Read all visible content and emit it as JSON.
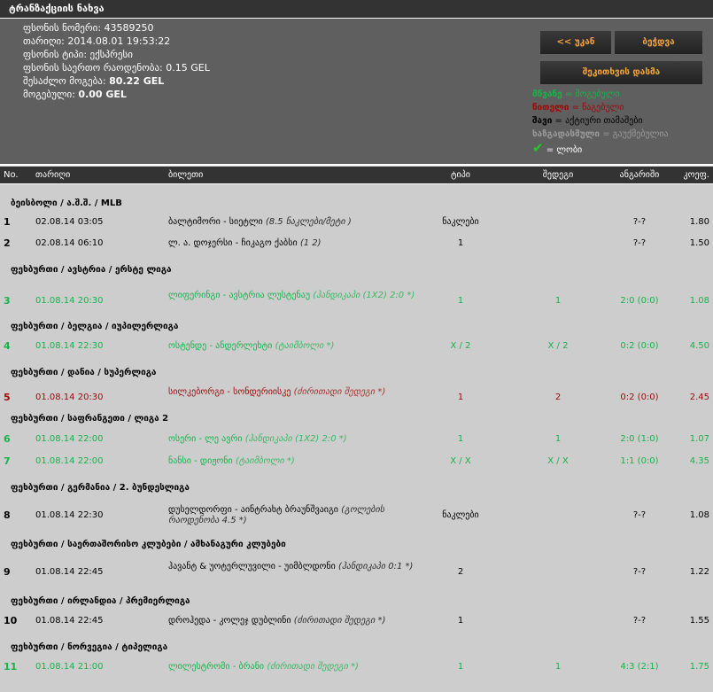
{
  "title": "ტრანზაქციის ნახვა",
  "info": {
    "bet_number_label": "ფსონის ნომერი:",
    "bet_number": "43589250",
    "date_label": "თარიღი:",
    "date": "2014.08.01 19:53:22",
    "bet_type_label": "ფსონის ტიპი:",
    "bet_type": "ექსპრესი",
    "stake_label": "ფსონის საერთო რაოდენობა:",
    "stake": "0.15 GEL",
    "possible_win_label": "შესაძლო მოგება:",
    "possible_win": "80.22 GEL",
    "won_label": "მოგებული:",
    "won": "0.00 GEL"
  },
  "buttons": {
    "back": "<< უკან",
    "print": "ბეჭდვა",
    "ask": "შეკითხვის დასმა"
  },
  "legend": [
    {
      "key": "მწვანე",
      "value": "= მოგებული",
      "color": "#17b34a"
    },
    {
      "key": "წითელი",
      "value": "= წაგებული",
      "color": "#9a0a0a"
    },
    {
      "key": "შავი",
      "value": "= აქტიური თამაშები",
      "color": "#000000"
    },
    {
      "key": "ხაზგადასმული",
      "value": "= გაუქმებულია",
      "color": "#9a9a9a"
    },
    {
      "key": "✔",
      "value": "= ლობი",
      "color": "#22cc22"
    }
  ],
  "columns": [
    "No.",
    "თარიღი",
    "ბილეთი",
    "ტიპი",
    "შედეგი",
    "ანგარიში",
    "კოეფ."
  ],
  "groups": [
    {
      "title": "ბეისბოლი / ა.შ.შ. / MLB",
      "rows": [
        {
          "no": "1",
          "date": "02.08.14 03:05",
          "match": "ბალტიმორი - სიეტლი",
          "market": "(8.5 ნაკლები/მეტი )",
          "type": "ნაკლები",
          "result": "",
          "score": "?-?",
          "coef": "1.80",
          "status": "black"
        },
        {
          "no": "2",
          "date": "02.08.14 06:10",
          "match": "ლ. ა. დოჯერსი - ჩიკაგო ქაბსი",
          "market": "(1 2)",
          "type": "1",
          "result": "",
          "score": "?-?",
          "coef": "1.50",
          "status": "black"
        }
      ]
    },
    {
      "title": "ფეხბურთი / ავსტრია / ერსტე ლიგა",
      "rows": [
        {
          "no": "3",
          "date": "01.08.14 20:30",
          "match": "ლიფერინგი - ავსტრია ლუსტენაუ",
          "market": "(ჰანდიკაპი (1X2) 2:0 *)",
          "type": "1",
          "result": "1",
          "score": "2:0 (0:0)",
          "coef": "1.08",
          "status": "green"
        }
      ]
    },
    {
      "title": "ფეხბურთი / ბელგია / იუპილერლიგა",
      "rows": [
        {
          "no": "4",
          "date": "01.08.14 22:30",
          "match": "ოსტენდე - ანდერლეხტი",
          "market": "(ტაიმბოლი *)",
          "type": "X / 2",
          "result": "X / 2",
          "score": "0:2 (0:0)",
          "coef": "4.50",
          "status": "green"
        }
      ]
    },
    {
      "title": "ფეხბურთი / დანია / სუპერლიგა",
      "rows": [
        {
          "no": "5",
          "date": "01.08.14 20:30",
          "match": "სილკებორგი - სონდერიისკე",
          "market": "(ძირითადი შედეგი *)",
          "type": "1",
          "result": "2",
          "score": "0:2 (0:0)",
          "coef": "2.45",
          "status": "red"
        }
      ]
    },
    {
      "title": "ფეხბურთი / საფრანგეთი / ლიგა 2",
      "rows": [
        {
          "no": "6",
          "date": "01.08.14 22:00",
          "match": "ოსერი - ლე ავრი",
          "market": "(ჰანდიკაპი (1X2) 2:0 *)",
          "type": "1",
          "result": "1",
          "score": "2:0 (1:0)",
          "coef": "1.07",
          "status": "green"
        },
        {
          "no": "7",
          "date": "01.08.14 22:00",
          "match": "ნანსი - დიჟონი",
          "market": "(ტაიმბოლი *)",
          "type": "X / X",
          "result": "X / X",
          "score": "1:1 (0:0)",
          "coef": "4.35",
          "status": "green"
        }
      ]
    },
    {
      "title": "ფეხბურთი / გერმანია / 2. ბუნდესლიგა",
      "rows": [
        {
          "no": "8",
          "date": "01.08.14 22:30",
          "match": "დუსელდორფი - აინტრახტ ბრაუნშვაიგი",
          "market": "(გოლების რაოდენობა 4.5 *)",
          "type": "ნაკლები",
          "result": "",
          "score": "?-?",
          "coef": "1.08",
          "status": "black"
        }
      ]
    },
    {
      "title": "ფეხბურთი / საერთაშორისო კლუბები / ამხანაგური კლუბები",
      "rows": [
        {
          "no": "9",
          "date": "01.08.14 22:45",
          "match": "ჰავანტ & უოტერლუვილი - უიმბლდონი",
          "market": "(ჰანდიკაპი 0:1 *)",
          "type": "2",
          "result": "",
          "score": "?-?",
          "coef": "1.22",
          "status": "black"
        }
      ]
    },
    {
      "title": "ფეხბურთი / ირლანდია / პრემიერლიგა",
      "rows": [
        {
          "no": "10",
          "date": "01.08.14 22:45",
          "match": "დროჰედა - კოლეჯ დუბლინი",
          "market": "(ძირითადი შედეგი *)",
          "type": "1",
          "result": "",
          "score": "?-?",
          "coef": "1.55",
          "status": "black"
        }
      ]
    },
    {
      "title": "ფეხბურთი / ნორვეგია / ტიპელიგა",
      "rows": [
        {
          "no": "11",
          "date": "01.08.14 21:00",
          "match": "ლილესტრომი - ბრანი",
          "market": "(ძირითადი შედეგი *)",
          "type": "1",
          "result": "1",
          "score": "4:3 (2:1)",
          "coef": "1.75",
          "status": "green"
        }
      ]
    }
  ]
}
